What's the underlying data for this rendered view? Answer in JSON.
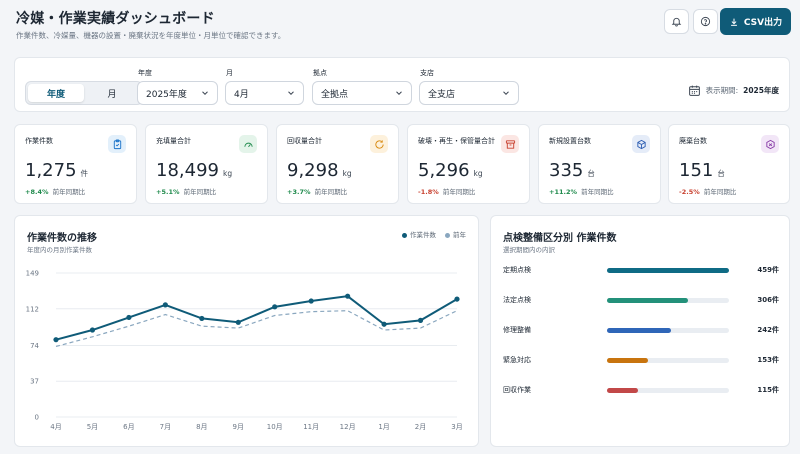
{
  "header": {
    "title": "冷媒・作業実績ダッシュボード",
    "subtitle": "作業件数、冷媒量、機器の設置・廃棄状況を年度単位・月単位で確認できます。",
    "csv_label": "CSV出力"
  },
  "filters": {
    "view_tabs": [
      "年度",
      "月"
    ],
    "active_tab": "年度",
    "year_label": "年度",
    "year_value": "2025年度",
    "month_label": "月",
    "month_value": "4月",
    "site_label": "拠点",
    "site_value": "全拠点",
    "branch_label": "支店",
    "branch_value": "全支店",
    "period_label": "表示期間:",
    "period_value": "2025年度"
  },
  "kpis": [
    {
      "label": "作業件数",
      "value": "1,275",
      "unit": "件",
      "change": "+8.4%",
      "direction": "up",
      "compare": "前年同期比",
      "icon": "clipboard-check-icon",
      "color": "#1a73c9",
      "bg": "#e3f0fb"
    },
    {
      "label": "充填量合計",
      "value": "18,499",
      "unit": "kg",
      "change": "+5.1%",
      "direction": "up",
      "compare": "前年同期比",
      "icon": "gauge-icon",
      "color": "#1f8a4c",
      "bg": "#e4f4ea"
    },
    {
      "label": "回収量合計",
      "value": "9,298",
      "unit": "kg",
      "change": "+3.7%",
      "direction": "up",
      "compare": "前年同期比",
      "icon": "recycle-icon",
      "color": "#d98a10",
      "bg": "#fdf1dc"
    },
    {
      "label": "破壊・再生・保管量合計",
      "value": "5,296",
      "unit": "kg",
      "change": "-1.8%",
      "direction": "down",
      "compare": "前年同期比",
      "icon": "archive-box-icon",
      "color": "#c8402f",
      "bg": "#fbe6e3"
    },
    {
      "label": "新規設置台数",
      "value": "335",
      "unit": "台",
      "change": "+11.2%",
      "direction": "up",
      "compare": "前年同期比",
      "icon": "cube-icon",
      "color": "#2f5fb3",
      "bg": "#e5ecf8"
    },
    {
      "label": "廃棄台数",
      "value": "151",
      "unit": "台",
      "change": "-2.5%",
      "direction": "down",
      "compare": "前年同期比",
      "icon": "cube-remove-icon",
      "color": "#8a3fa8",
      "bg": "#f2e6f7"
    }
  ],
  "trend": {
    "title": "作業件数の推移",
    "subtitle": "年度内の月別作業件数",
    "legend_current": "作業件数",
    "legend_previous": "前年"
  },
  "chart_data": {
    "type": "line",
    "categories": [
      "4月",
      "5月",
      "6月",
      "7月",
      "8月",
      "9月",
      "10月",
      "11月",
      "12月",
      "1月",
      "2月",
      "3月"
    ],
    "series": [
      {
        "name": "作業件数",
        "values": [
          80,
          90,
          103,
          116,
          102,
          98,
          114,
          120,
          125,
          96,
          100,
          122
        ],
        "color": "#0f5b78",
        "style": "solid"
      },
      {
        "name": "前年",
        "values": [
          73,
          83,
          94,
          106,
          94,
          92,
          105,
          109,
          110,
          90,
          92,
          110
        ],
        "color": "#8aa7bf",
        "style": "dashed"
      }
    ],
    "yticks": [
      0,
      37,
      74,
      112,
      149
    ],
    "ylim": [
      0,
      149
    ],
    "grid": true,
    "legend": "top-right"
  },
  "categories_panel": {
    "title": "点検整備区分別 作業件数",
    "subtitle": "選択期間内の内訳",
    "max": 459,
    "items": [
      {
        "name": "定期点検",
        "value": 459,
        "label": "459件",
        "color": "#0f6b85"
      },
      {
        "name": "法定点検",
        "value": 306,
        "label": "306件",
        "color": "#23917a"
      },
      {
        "name": "修理整備",
        "value": 242,
        "label": "242件",
        "color": "#2f66b8"
      },
      {
        "name": "緊急対応",
        "value": 153,
        "label": "153件",
        "color": "#c8740e"
      },
      {
        "name": "回収作業",
        "value": 115,
        "label": "115件",
        "color": "#c24848"
      }
    ]
  }
}
